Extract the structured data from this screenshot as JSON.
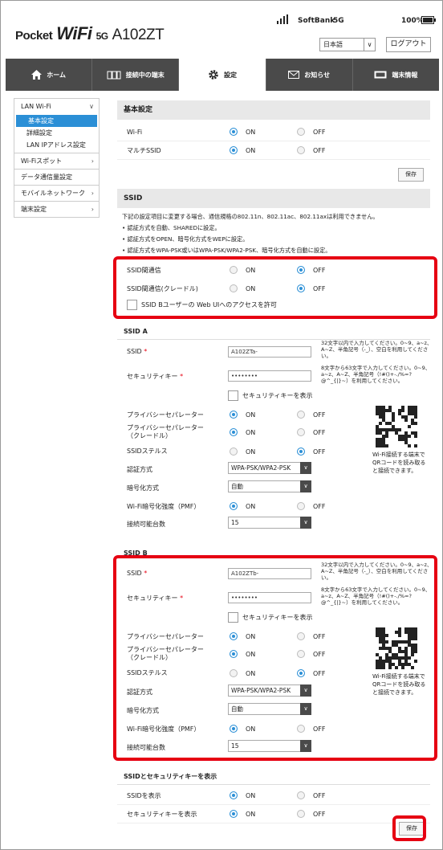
{
  "header": {
    "logo_prefix": "Pocket",
    "logo_wifi": "WiFi",
    "logo_5g": "5G",
    "logo_model": "A102ZT",
    "carrier": "SoftBank",
    "network": "5G",
    "sim": "S",
    "battery": "100%",
    "language": "日本語",
    "logout": "ログアウト"
  },
  "nav": {
    "tabs": [
      {
        "label": "ホーム",
        "icon": "home-icon"
      },
      {
        "label": "接続中の端末",
        "icon": "devices-icon"
      },
      {
        "label": "設定",
        "icon": "gear-icon"
      },
      {
        "label": "お知らせ",
        "icon": "mail-icon"
      },
      {
        "label": "端末情報",
        "icon": "device-info-icon"
      }
    ]
  },
  "sidebar": {
    "lan_wifi": "LAN Wi-Fi",
    "sub": [
      "基本設定",
      "詳細設定",
      "LAN IPアドレス設定"
    ],
    "items": [
      "Wi-Fiスポット",
      "データ通信量設定",
      "モバイルネットワーク",
      "端末設定"
    ]
  },
  "basic": {
    "title": "基本設定",
    "wifi_label": "Wi-Fi",
    "multi_label": "マルチSSID",
    "on": "ON",
    "off": "OFF",
    "save": "保存"
  },
  "ssid": {
    "title": "SSID",
    "notes": [
      "下記の設定項目に変更する場合、通信規格の802.11n、802.11ac、802.11axは利用できません。",
      "• 認証方式を自動、SHAREDに設定。",
      "• 認証方式をOPEN、暗号化方式をWEPに設定。",
      "• 認証方式をWPA-PSK或いはWPA-PSK/WPA2-PSK、暗号化方式を自動に設定。"
    ],
    "isolation": "SSID間通信",
    "isolation_cradle": "SSID間通信(クレードル)",
    "webui_access": "SSID Bユーザーの Web UIへのアクセスを許可"
  },
  "ssid_a": {
    "title": "SSID A",
    "ssid_label": "SSID",
    "ssid_value": "A102ZTa-",
    "ssid_hint": "32文字以内で入力してください。0~9、a~z、A~Z、半角記号（-_）、空白を利用してください。",
    "key_label": "セキュリティキー",
    "key_value": "••••••••",
    "key_hint": "8文字から63文字で入力してください。0~9、a~z、A~Z、半角記号（!#()+-./%=?@^_{|}~）を利用してください。",
    "show_key": "セキュリティキーを表示",
    "privacy": "プライバシーセパレーター",
    "privacy_cradle_1": "プライバシーセパレーター",
    "privacy_cradle_2": "（クレードル）",
    "stealth": "SSIDステルス",
    "auth_label": "認証方式",
    "auth_value": "WPA-PSK/WPA2-PSK",
    "enc_label": "暗号化方式",
    "enc_value": "自動",
    "pmf_label": "Wi-Fi暗号化強度（PMF）",
    "max_label": "接続可能台数",
    "max_value": "15",
    "qr_text": "Wi-Fi接続する端末でQRコードを読み取ると接続できます。"
  },
  "ssid_b": {
    "title": "SSID B",
    "ssid_label": "SSID",
    "ssid_value": "A102ZTb-",
    "ssid_hint": "32文字以内で入力してください。0~9、a~z、A~Z、半角記号（-_）、空白を利用してください。",
    "key_label": "セキュリティキー",
    "key_value": "••••••••",
    "key_hint": "8文字から63文字で入力してください。0~9、a~z、A~Z、半角記号（!#()+-./%=?@^_{|}~）を利用してください。",
    "show_key": "セキュリティキーを表示",
    "privacy": "プライバシーセパレーター",
    "privacy_cradle_1": "プライバシーセパレーター",
    "privacy_cradle_2": "（クレードル）",
    "stealth": "SSIDステルス",
    "auth_label": "認証方式",
    "auth_value": "WPA-PSK/WPA2-PSK",
    "enc_label": "暗号化方式",
    "enc_value": "自動",
    "pmf_label": "Wi-Fi暗号化強度（PMF）",
    "max_label": "接続可能台数",
    "max_value": "15",
    "qr_text": "Wi-Fi接続する端末でQRコードを読み取ると接続できます。"
  },
  "display": {
    "title": "SSIDとセキュリティキーを表示",
    "show_ssid": "SSIDを表示",
    "show_key": "セキュリティキーを表示",
    "save": "保存"
  },
  "colors": {
    "accent": "#2b8fd6",
    "highlight": "#e60012",
    "nav": "#4a4a4a"
  }
}
